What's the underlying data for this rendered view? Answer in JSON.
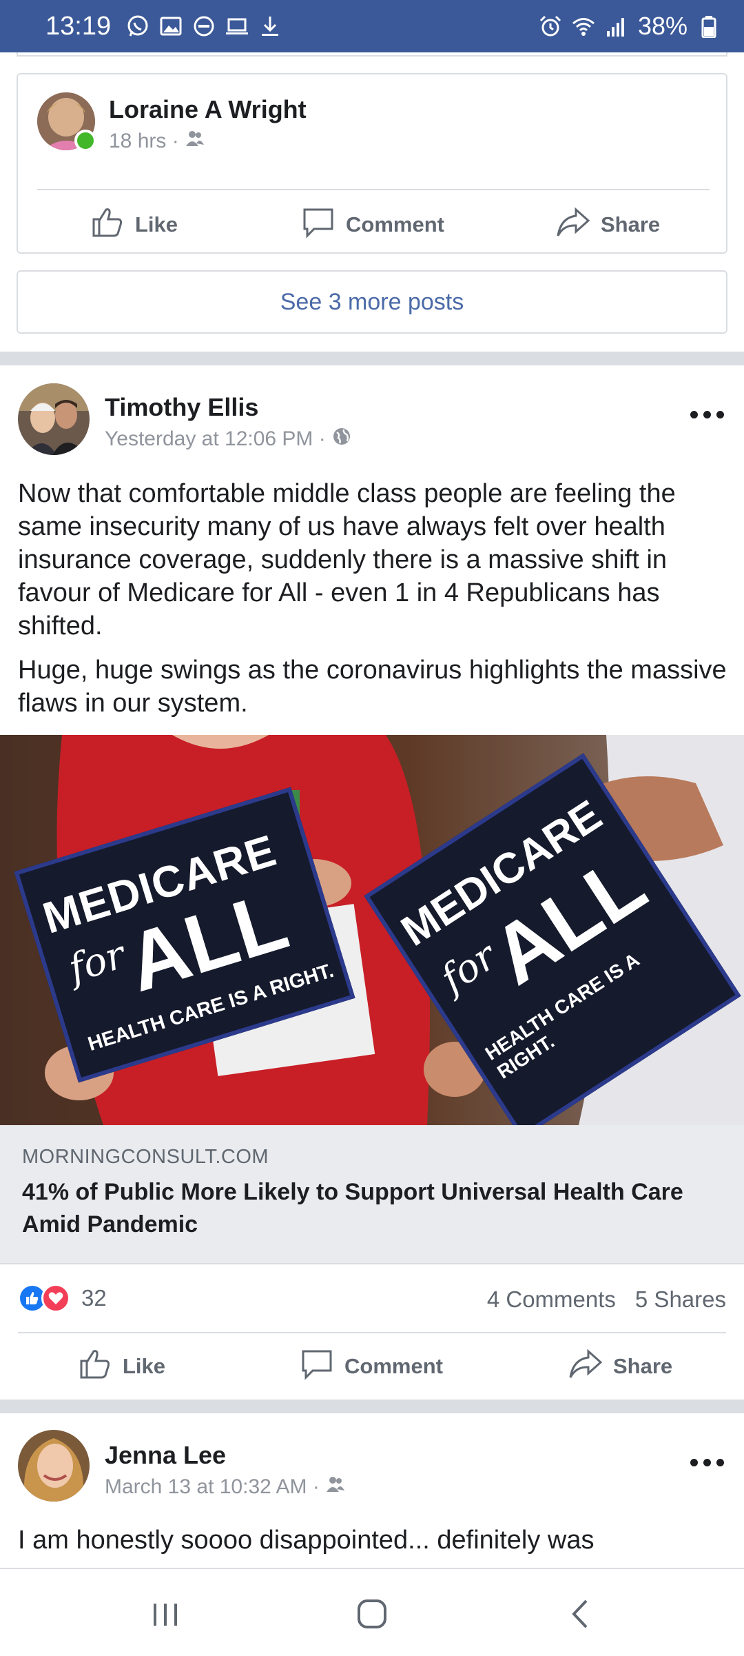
{
  "status_bar": {
    "time": "13:19",
    "battery": "38%",
    "left_icons": [
      "whatsapp-icon",
      "gallery-icon",
      "dnd-icon",
      "laptop-icon",
      "download-icon"
    ],
    "right_icons": [
      "alarm-icon",
      "wifi-icon",
      "signal-icon",
      "battery-icon"
    ]
  },
  "post1": {
    "author": "Loraine A Wright",
    "time": "18 hrs ·",
    "audience_icon": "friends-icon",
    "online": true
  },
  "actions": {
    "like": "Like",
    "comment": "Comment",
    "share": "Share"
  },
  "see_more": "See 3 more posts",
  "post2": {
    "author": "Timothy Ellis",
    "time": "Yesterday at 12:06 PM ·",
    "audience_icon": "globe-icon",
    "paragraph1": "Now that comfortable middle class people are feeling the same insecurity many of us have always felt over health insurance coverage, suddenly there is a massive shift in favour of Medicare for All - even 1 in 4 Republicans has shifted.",
    "paragraph2": "Huge, huge swings as the coronavirus highlights the massive flaws in our system.",
    "link": {
      "domain": "MORNINGCONSULT.COM",
      "title": "41% of Public More Likely to Support Universal Health Care Amid Pandemic",
      "sign_top": "MEDICARE",
      "sign_for": "for",
      "sign_all": "ALL",
      "sign_bottom": "HEALTH CARE IS A RIGHT."
    },
    "reactions_count": "32",
    "comments": "4 Comments",
    "shares": "5 Shares"
  },
  "post3": {
    "author": "Jenna Lee",
    "time": "March 13 at 10:32 AM ·",
    "audience_icon": "friends-icon",
    "text": "I am honestly soooo disappointed... definitely was"
  },
  "colors": {
    "status_bar": "#3b5998",
    "link_blue": "#4b6aa8",
    "online_green": "#42b72a",
    "like_blue": "#1877f2",
    "love_red": "#f33e58"
  }
}
